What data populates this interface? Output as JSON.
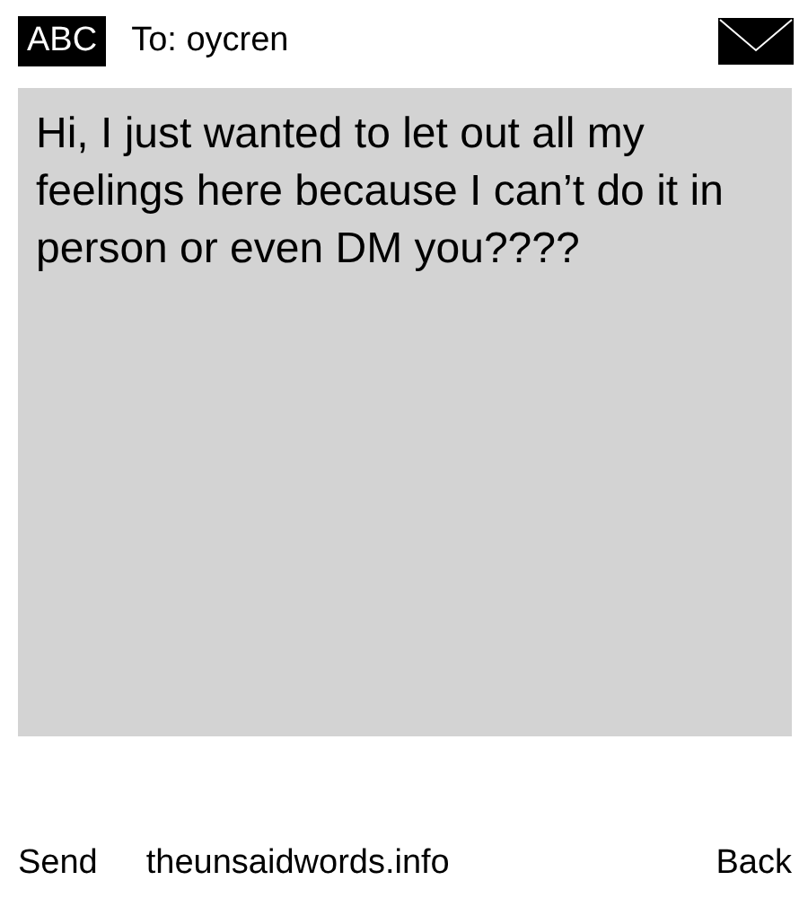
{
  "header": {
    "input_mode": "ABC",
    "recipient": "To: oycren"
  },
  "message": {
    "value": "Hi, I just wanted to let out all my feelings here because I can’t do it in person or even DM you????"
  },
  "footer": {
    "left": "Send",
    "center": "theunsaidwords.info",
    "right": "Back"
  }
}
